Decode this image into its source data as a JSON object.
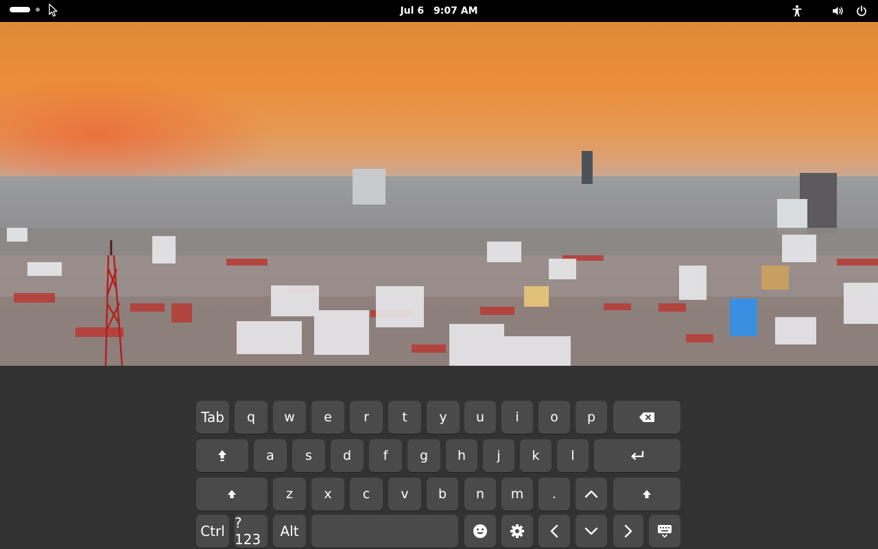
{
  "topbar": {
    "date": "Jul 6",
    "time": "9:07 AM",
    "tray_icons": [
      "accessibility-icon",
      "volume-icon",
      "power-icon"
    ]
  },
  "keyboard": {
    "row1": [
      "Tab",
      "q",
      "w",
      "e",
      "r",
      "t",
      "y",
      "u",
      "i",
      "o",
      "p"
    ],
    "row2": [
      "a",
      "s",
      "d",
      "f",
      "g",
      "h",
      "j",
      "k",
      "l"
    ],
    "row3": [
      "z",
      "x",
      "c",
      "v",
      "b",
      "n",
      "m",
      "."
    ],
    "row4": {
      "ctrl": "Ctrl",
      "symbols": "?123",
      "alt": "Alt"
    },
    "icons": [
      "backspace-icon",
      "enter-icon",
      "shift-icon",
      "up-arrow-icon",
      "emoji-icon",
      "settings-gear-icon",
      "left-arrow-icon",
      "down-arrow-icon",
      "right-arrow-icon",
      "hide-keyboard-icon"
    ]
  },
  "colors": {
    "panel": "#000000",
    "keyboard_bg": "#323232",
    "key_bg": "#4a4a4a",
    "key_text": "#ffffff"
  }
}
